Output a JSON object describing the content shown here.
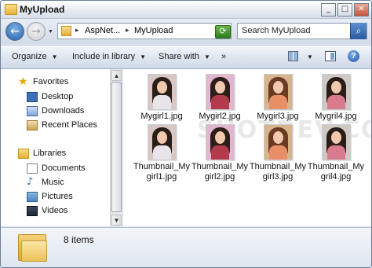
{
  "window": {
    "title": "MyUpload",
    "buttons": {
      "minimize": "_",
      "maximize": "□",
      "close": "✕"
    }
  },
  "address": {
    "breadcrumbs": [
      "AspNet...",
      "MyUpload"
    ],
    "separator": "▸",
    "dropdown": "▾"
  },
  "search": {
    "placeholder": "Search MyUpload"
  },
  "toolbar": {
    "organize": "Organize",
    "include_in_library": "Include in library",
    "share_with": "Share with",
    "more": "»"
  },
  "nav": {
    "favorites_header": "Favorites",
    "favorites": [
      "Desktop",
      "Downloads",
      "Recent Places"
    ],
    "libraries_header": "Libraries",
    "libraries": [
      "Documents",
      "Music",
      "Pictures",
      "Videos"
    ]
  },
  "files": [
    {
      "name": "Mygirl1.jpg"
    },
    {
      "name": "Mygirl2.jpg"
    },
    {
      "name": "Mygirl3.jpg"
    },
    {
      "name": "Mygril4.jpg"
    },
    {
      "name": "Thumbnail_Mygirl1.jpg"
    },
    {
      "name": "Thumbnail_Mygirl2.jpg"
    },
    {
      "name": "Thumbnail_Mygirl3.jpg"
    },
    {
      "name": "Thumbnail_Mygril4.jpg"
    }
  ],
  "watermark": "SHOTDEV.COM",
  "status": {
    "item_count": "8 items"
  },
  "colors": {
    "accent": "#1f5fa6",
    "folder": "#e4ae3a"
  }
}
